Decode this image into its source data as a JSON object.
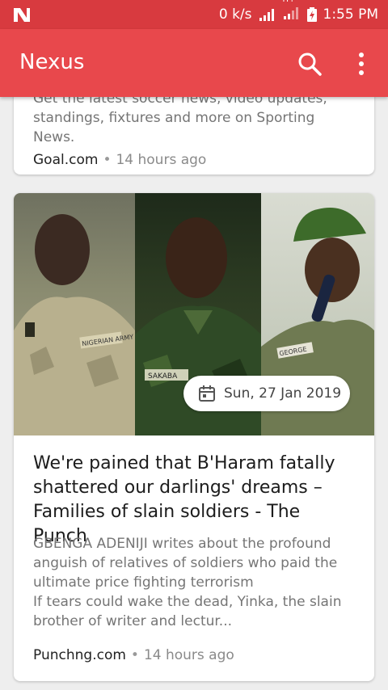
{
  "status_bar": {
    "network_speed": "0 k/s",
    "network_type": "H+",
    "time": "1:55 PM"
  },
  "app_bar": {
    "title": "Nexus",
    "search_icon": "search-icon",
    "menu_icon": "more-vert-icon"
  },
  "colors": {
    "status_bar": "#d83a3f",
    "app_bar": "#e8484c"
  },
  "cards": [
    {
      "description": "Get the latest soccer news, video updates, standings, fixtures and more on Sporting News.",
      "source": "Goal.com",
      "time_ago": "14 hours ago"
    },
    {
      "date": "Sun, 27 Jan 2019",
      "title": "We're pained that B'Haram fatally shattered our darlings' dreams –Families of slain soldiers - The Punch",
      "description": "GBENGA ADENIJI writes about the profound anguish of relatives of soldiers who paid the ultimate price fighting terrorism\nIf tears could wake the dead, Yinka, the slain brother of writer and lectur...",
      "source": "Punchng.com",
      "time_ago": "14 hours ago",
      "image_labels": [
        "NIGERIAN ARMY",
        "SAKABA",
        "GEORGE"
      ]
    }
  ]
}
